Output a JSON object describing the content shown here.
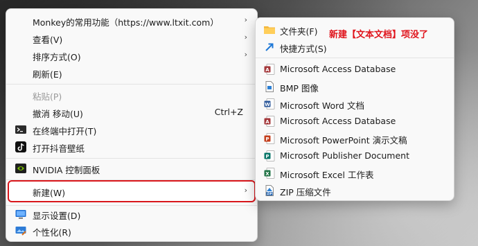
{
  "main_menu": {
    "items": [
      {
        "label": "Monkey的常用功能（https://www.ltxit.com）",
        "arrow": "›"
      },
      {
        "label": "查看(V)",
        "arrow": "›"
      },
      {
        "label": "排序方式(O)",
        "arrow": "›"
      },
      {
        "label": "刷新(E)"
      },
      {
        "label": "粘贴(P)",
        "disabled": true
      },
      {
        "label": "撤消 移动(U)",
        "shortcut": "Ctrl+Z"
      },
      {
        "label": "在终端中打开(T)",
        "icon": "terminal-icon"
      },
      {
        "label": "打开抖音壁纸",
        "icon": "tiktok-icon"
      },
      {
        "label": "NVIDIA 控制面板",
        "icon": "nvidia-icon"
      },
      {
        "label": "新建(W)",
        "arrow": "›",
        "highlighted": true
      },
      {
        "label": "显示设置(D)",
        "icon": "display-settings-icon"
      },
      {
        "label": "个性化(R)",
        "icon": "personalize-icon"
      }
    ]
  },
  "submenu": {
    "annotation": "新建【文本文档】项没了",
    "items": [
      {
        "label": "文件夹(F)",
        "icon": "folder-icon"
      },
      {
        "label": "快捷方式(S)",
        "icon": "shortcut-icon"
      },
      {
        "label": "Microsoft Access Database",
        "icon": "access-icon"
      },
      {
        "label": "BMP 图像",
        "icon": "bmp-icon"
      },
      {
        "label": "Microsoft Word 文档",
        "icon": "word-icon"
      },
      {
        "label": "Microsoft Access Database",
        "icon": "access-icon"
      },
      {
        "label": "Microsoft PowerPoint 演示文稿",
        "icon": "powerpoint-icon"
      },
      {
        "label": "Microsoft Publisher Document",
        "icon": "publisher-icon"
      },
      {
        "label": "Microsoft Excel 工作表",
        "icon": "excel-icon"
      },
      {
        "label": "ZIP 压缩文件",
        "icon": "zip-icon"
      }
    ]
  },
  "colors": {
    "highlight_border": "#d9161b",
    "annotation": "#e0141c"
  }
}
